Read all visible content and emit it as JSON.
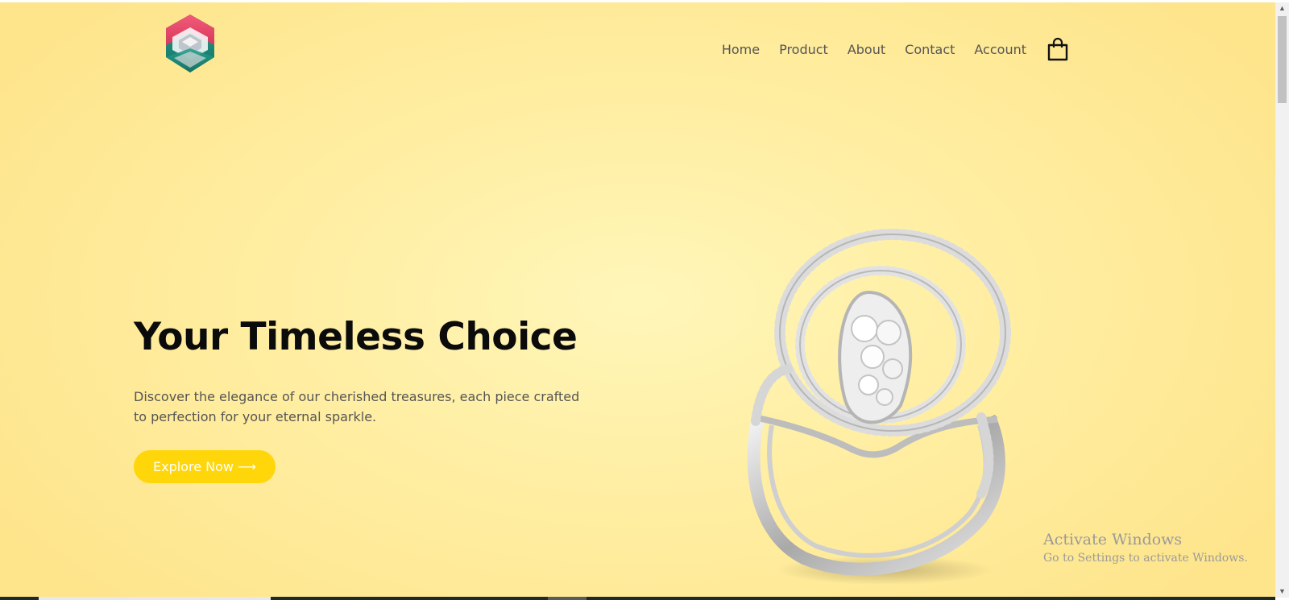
{
  "brand": {
    "logo_icon": "layered-diamond-logo",
    "colors": [
      "#ef4f6e",
      "#1f8f80",
      "#c9c9c9"
    ]
  },
  "nav": {
    "items": [
      {
        "label": "Home"
      },
      {
        "label": "Product"
      },
      {
        "label": "About"
      },
      {
        "label": "Contact"
      },
      {
        "label": "Account"
      }
    ],
    "cart_icon": "shopping-bag-icon"
  },
  "hero": {
    "title": "Your Timeless Choice",
    "description": "Discover the elegance of our cherished treasures, each piece crafted to perfection for your eternal sparkle.",
    "cta_label": "Explore Now ⟶",
    "image": "diamond-ring-image"
  },
  "watermark": {
    "line1": "Activate Windows",
    "line2": "Go to Settings to activate Windows."
  },
  "colors": {
    "accent": "#ffd60a",
    "background": "#ffeea2",
    "title": "#0b0b0b",
    "text": "#555555"
  }
}
